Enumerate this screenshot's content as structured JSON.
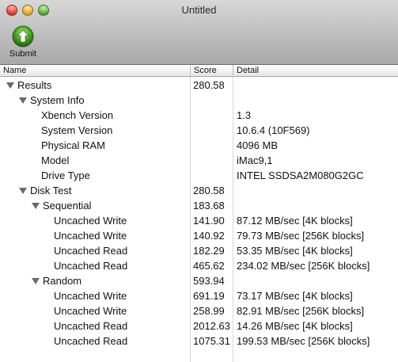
{
  "window": {
    "title": "Untitled",
    "toolbar": {
      "submit_label": "Submit",
      "submit_icon": "green-up-arrow-icon"
    }
  },
  "columns": {
    "name": "Name",
    "score": "Score",
    "detail": "Detail"
  },
  "rows": [
    {
      "name": "Results",
      "score": "280.58",
      "detail": "",
      "level": 0,
      "expandable": true
    },
    {
      "name": "System Info",
      "score": "",
      "detail": "",
      "level": 1,
      "expandable": true
    },
    {
      "name": "Xbench Version",
      "score": "",
      "detail": "1.3",
      "level": 2,
      "expandable": false
    },
    {
      "name": "System Version",
      "score": "",
      "detail": "10.6.4 (10F569)",
      "level": 2,
      "expandable": false
    },
    {
      "name": "Physical RAM",
      "score": "",
      "detail": "4096 MB",
      "level": 2,
      "expandable": false
    },
    {
      "name": "Model",
      "score": "",
      "detail": "iMac9,1",
      "level": 2,
      "expandable": false
    },
    {
      "name": "Drive Type",
      "score": "",
      "detail": "INTEL SSDSA2M080G2GC",
      "level": 2,
      "expandable": false
    },
    {
      "name": "Disk Test",
      "score": "280.58",
      "detail": "",
      "level": 1,
      "expandable": true
    },
    {
      "name": "Sequential",
      "score": "183.68",
      "detail": "",
      "level": 2,
      "expandable": true
    },
    {
      "name": "Uncached Write",
      "score": "141.90",
      "detail": "87.12 MB/sec [4K blocks]",
      "level": 3,
      "expandable": false
    },
    {
      "name": "Uncached Write",
      "score": "140.92",
      "detail": "79.73 MB/sec [256K blocks]",
      "level": 3,
      "expandable": false
    },
    {
      "name": "Uncached Read",
      "score": "182.29",
      "detail": "53.35 MB/sec [4K blocks]",
      "level": 3,
      "expandable": false
    },
    {
      "name": "Uncached Read",
      "score": "465.62",
      "detail": "234.02 MB/sec [256K blocks]",
      "level": 3,
      "expandable": false
    },
    {
      "name": "Random",
      "score": "593.94",
      "detail": "",
      "level": 2,
      "expandable": true
    },
    {
      "name": "Uncached Write",
      "score": "691.19",
      "detail": "73.17 MB/sec [4K blocks]",
      "level": 3,
      "expandable": false
    },
    {
      "name": "Uncached Write",
      "score": "258.99",
      "detail": "82.91 MB/sec [256K blocks]",
      "level": 3,
      "expandable": false
    },
    {
      "name": "Uncached Read",
      "score": "2012.63",
      "detail": "14.26 MB/sec [4K blocks]",
      "level": 3,
      "expandable": false
    },
    {
      "name": "Uncached Read",
      "score": "1075.31",
      "detail": "199.53 MB/sec [256K blocks]",
      "level": 3,
      "expandable": false
    }
  ]
}
